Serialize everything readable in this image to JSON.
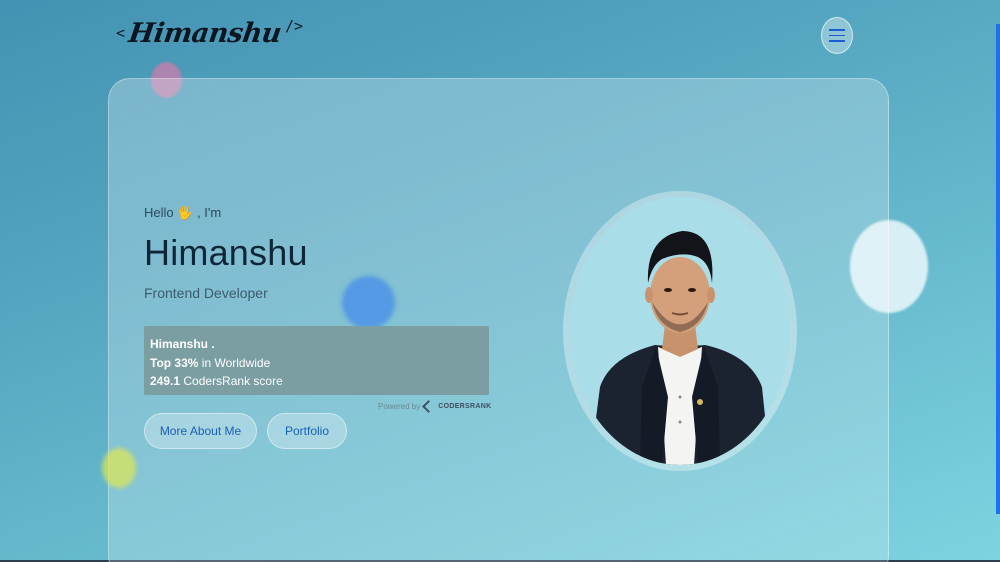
{
  "header": {
    "logo_open": "<",
    "logo_name": "Himanshu",
    "logo_close": "/>",
    "menu_icon": "hamburger-icon"
  },
  "hero": {
    "greeting": "Hello",
    "greeting_emoji": "🖐",
    "greeting_suffix": ", I'm",
    "name": "Himanshu",
    "role": "Frontend Developer"
  },
  "codersrank": {
    "user": "Himanshu .",
    "rank_value": "Top 33%",
    "rank_suffix": "in Worldwide",
    "score_value": "249.1",
    "score_suffix": "CodersRank score",
    "powered_by": "Powered by",
    "brand": "CODERSRANK"
  },
  "buttons": {
    "about": "More About Me",
    "portfolio": "Portfolio"
  },
  "colors": {
    "accent": "#1a5fb4",
    "widget_bg": "#7b9ea3",
    "title": "#0f2638"
  }
}
